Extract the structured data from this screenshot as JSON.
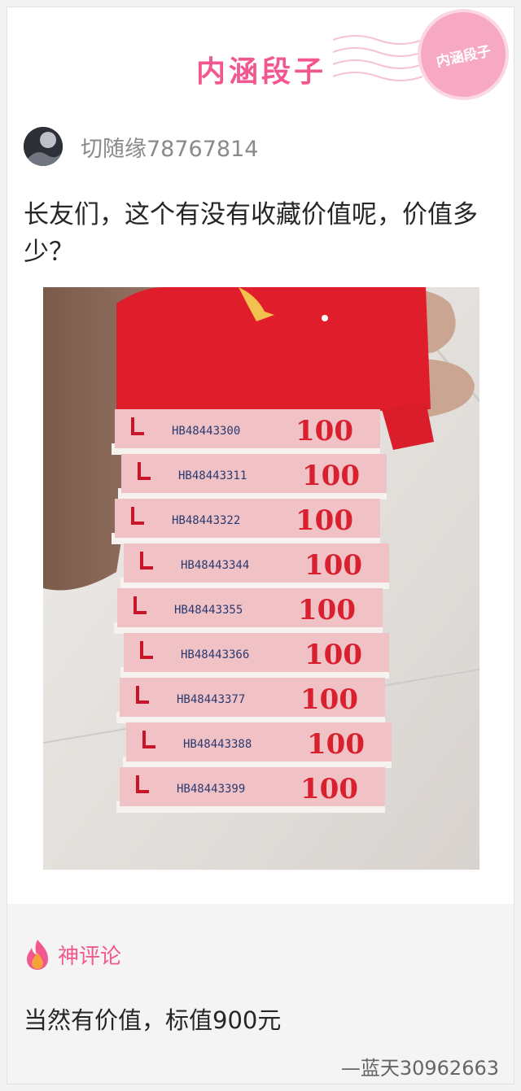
{
  "header": {
    "brand": "内涵段子",
    "stamp": "内涵段子"
  },
  "post": {
    "author_name": "切随缘78767814",
    "text": "长友们，这个有没有收藏价值呢，价值多少？",
    "photo": {
      "banknotes": [
        {
          "serial": "HB48443300",
          "denomination": "100"
        },
        {
          "serial": "HB48443311",
          "denomination": "100"
        },
        {
          "serial": "HB48443322",
          "denomination": "100"
        },
        {
          "serial": "HB48443344",
          "denomination": "100"
        },
        {
          "serial": "HB48443355",
          "denomination": "100"
        },
        {
          "serial": "HB48443366",
          "denomination": "100"
        },
        {
          "serial": "HB48443377",
          "denomination": "100"
        },
        {
          "serial": "HB48443388",
          "denomination": "100"
        },
        {
          "serial": "HB48443399",
          "denomination": "100"
        }
      ]
    }
  },
  "comments": {
    "title": "神评论",
    "text": "当然有价值，标值900元",
    "author": "—蓝天30962663"
  },
  "colors": {
    "brand": "#f2588f",
    "envelope": "#e01e2b",
    "banknote": "#f0c2c6"
  }
}
